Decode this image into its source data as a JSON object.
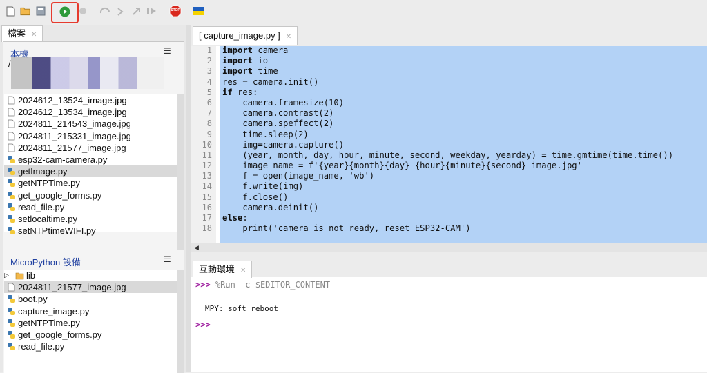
{
  "colors": {
    "accent_red": "#e63b2e",
    "selection": "#b3d2f6",
    "prompt": "#a020a0",
    "panel_title": "#2040a0"
  },
  "toolbar": {
    "icons": [
      "new-file-icon",
      "open-file-icon",
      "save-icon",
      "run-icon",
      "debug-icon",
      "step-over-icon",
      "step-into-icon",
      "step-out-icon",
      "resume-icon",
      "stop-icon",
      "ukraine-flag-icon"
    ],
    "stop_label": "STOP"
  },
  "files_panel": {
    "tab_label": "檔案",
    "local": {
      "title": "本機",
      "path_partial": "/",
      "files": [
        {
          "name": "2024612_13524_image.jpg",
          "type": "file"
        },
        {
          "name": "2024612_13534_image.jpg",
          "type": "file"
        },
        {
          "name": "2024811_214543_image.jpg",
          "type": "file"
        },
        {
          "name": "2024811_215331_image.jpg",
          "type": "file"
        },
        {
          "name": "2024811_21577_image.jpg",
          "type": "file"
        },
        {
          "name": "esp32-cam-camera.py",
          "type": "python"
        },
        {
          "name": "getImage.py",
          "type": "python",
          "selected": true
        },
        {
          "name": "getNTPTime.py",
          "type": "python"
        },
        {
          "name": "get_google_forms.py",
          "type": "python"
        },
        {
          "name": "read_file.py",
          "type": "python"
        },
        {
          "name": "setlocaltime.py",
          "type": "python"
        },
        {
          "name": "setNTPtimeWIFI.py",
          "type": "python"
        }
      ]
    },
    "device": {
      "title": "MicroPython 設備",
      "files": [
        {
          "name": "lib",
          "type": "folder"
        },
        {
          "name": "2024811_21577_image.jpg",
          "type": "file",
          "selected": true
        },
        {
          "name": "boot.py",
          "type": "python"
        },
        {
          "name": "capture_image.py",
          "type": "python"
        },
        {
          "name": "getNTPTime.py",
          "type": "python"
        },
        {
          "name": "get_google_forms.py",
          "type": "python"
        },
        {
          "name": "read_file.py",
          "type": "python"
        }
      ]
    }
  },
  "editor": {
    "tab_label": "[ capture_image.py ]",
    "lines": [
      {
        "n": "1",
        "t": "import camera"
      },
      {
        "n": "2",
        "t": "import io"
      },
      {
        "n": "3",
        "t": "import time"
      },
      {
        "n": "4",
        "t": "res = camera.init()"
      },
      {
        "n": "5",
        "t": "if res:"
      },
      {
        "n": "6",
        "t": "    camera.framesize(10)"
      },
      {
        "n": "7",
        "t": "    camera.contrast(2)"
      },
      {
        "n": "8",
        "t": "    camera.speffect(2)"
      },
      {
        "n": "9",
        "t": "    time.sleep(2)"
      },
      {
        "n": "10",
        "t": "    img=camera.capture()"
      },
      {
        "n": "11",
        "t": "    (year, month, day, hour, minute, second, weekday, yearday) = time.gmtime(time.time())"
      },
      {
        "n": "12",
        "t": "    image_name = f'{year}{month}{day}_{hour}{minute}{second}_image.jpg'"
      },
      {
        "n": "13",
        "t": "    f = open(image_name, 'wb')"
      },
      {
        "n": "14",
        "t": "    f.write(img)"
      },
      {
        "n": "15",
        "t": "    f.close()"
      },
      {
        "n": "16",
        "t": "    camera.deinit()"
      },
      {
        "n": "17",
        "t": "else:"
      },
      {
        "n": "18",
        "t": "    print('camera is not ready, reset ESP32-CAM')"
      }
    ]
  },
  "shell": {
    "tab_label": "互動環境",
    "prompt": ">>>",
    "command": "%Run -c $EDITOR_CONTENT",
    "output": "MPY: soft reboot"
  }
}
